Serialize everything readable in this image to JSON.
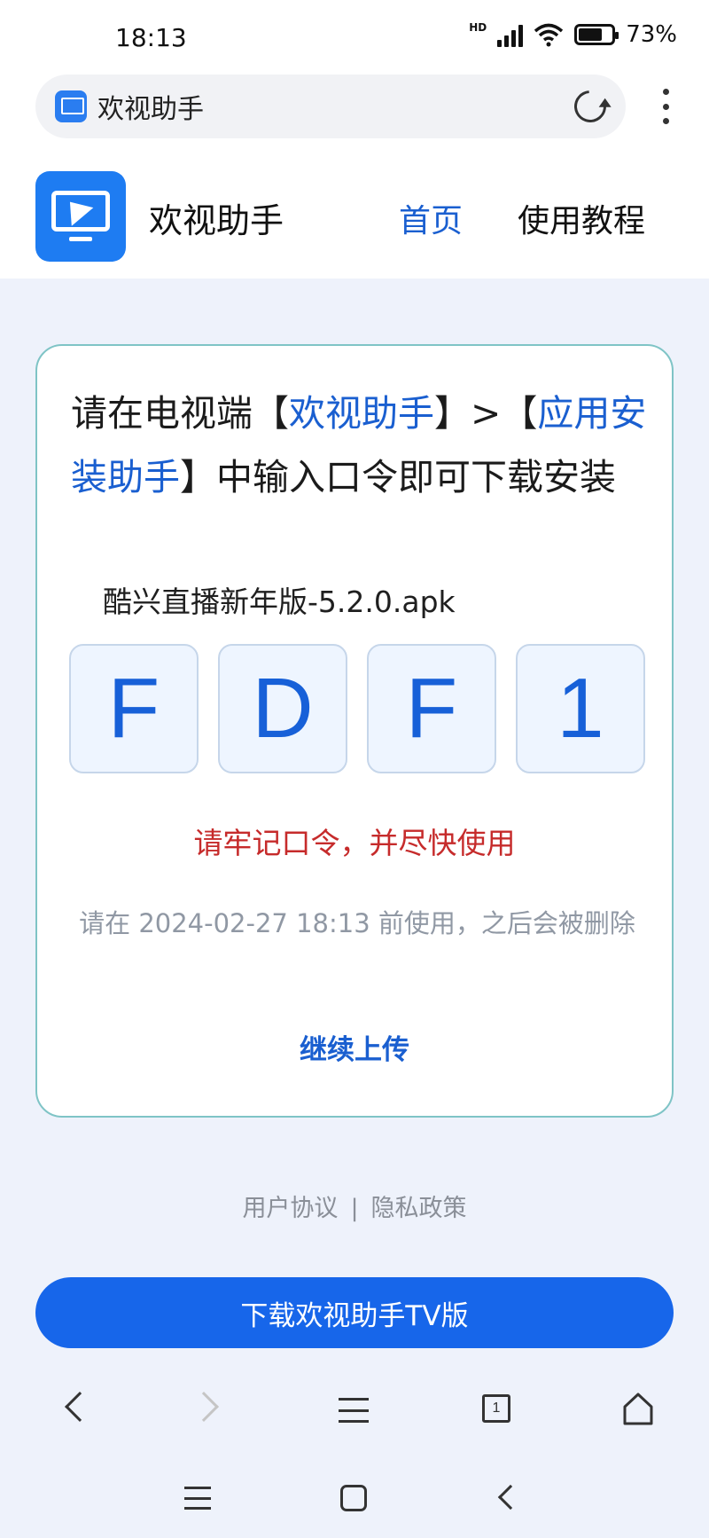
{
  "status_bar": {
    "time": "18:13",
    "network": "HD",
    "battery": "73%",
    "battery_level": 0.73
  },
  "browser": {
    "tab_title": "欢视助手",
    "icons": [
      "reload-icon",
      "more-icon"
    ]
  },
  "site": {
    "name": "欢视助手",
    "nav": {
      "home": "首页",
      "tutorial": "使用教程"
    }
  },
  "card": {
    "instruction_parts": [
      "请在电视端【",
      "欢视助手",
      "】>【",
      "应用安装助手",
      "】中输入口令即可下载安装"
    ],
    "filename": "酷兴直播新年版-5.2.0.apk",
    "code": [
      "F",
      "D",
      "F",
      "1"
    ],
    "remember": "请牢记口令，并尽快使用",
    "expire": "请在 2024-02-27 18:13 前使用，之后会被删除",
    "continue": "继续上传"
  },
  "footer": {
    "user_agreement": "用户协议",
    "separator": "|",
    "privacy": "隐私政策"
  },
  "download_button": "下载欢视助手TV版",
  "toolbar": {
    "tab_count": "1",
    "icons": [
      "back-icon",
      "forward-icon",
      "menu-icon",
      "tabs-icon",
      "home-icon"
    ]
  },
  "colors": {
    "accent": "#1766ea",
    "link": "#1a5fd0",
    "warning": "#c62b2b",
    "card_border": "#7fc4c6"
  }
}
